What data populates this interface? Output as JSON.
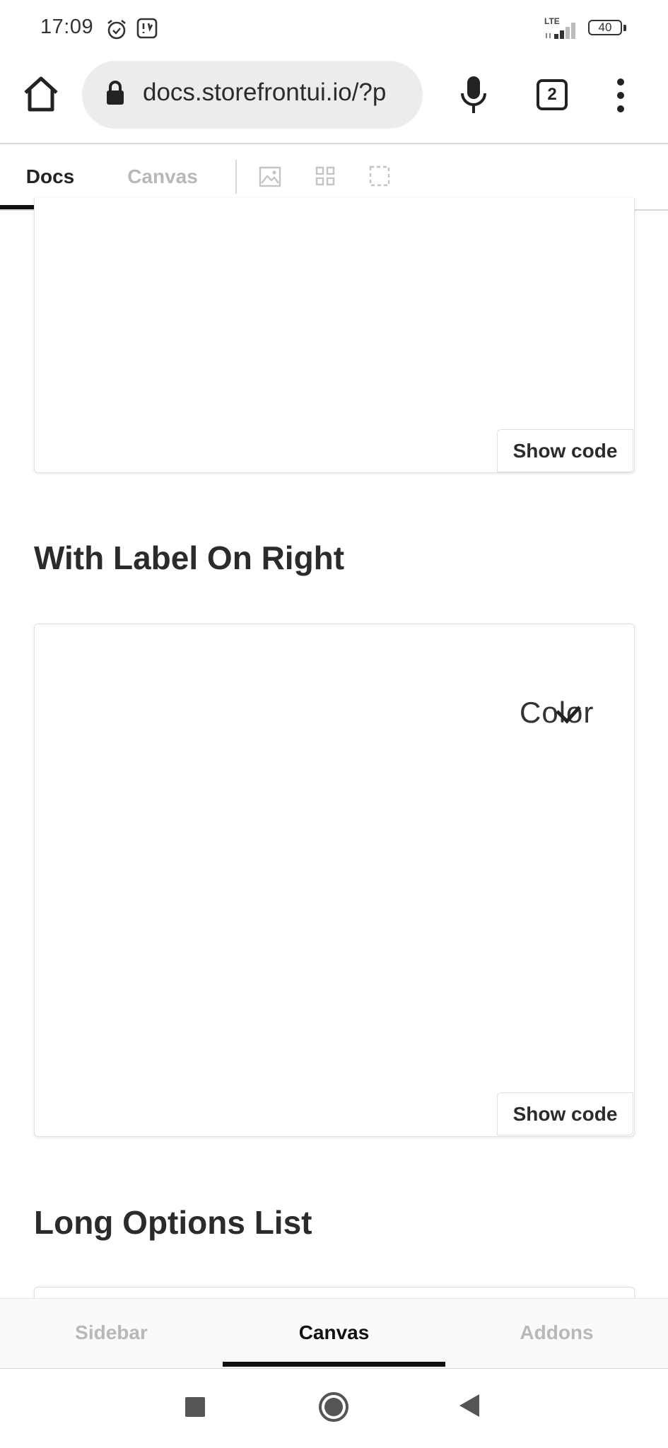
{
  "status_bar": {
    "time": "17:09",
    "network": "LTE",
    "battery": "40"
  },
  "browser": {
    "url": "docs.storefrontui.io/?p",
    "tab_count": "2"
  },
  "docs_tabs": {
    "docs": "Docs",
    "canvas": "Canvas"
  },
  "content": {
    "show_code_label": "Show code",
    "section_label_right": "With Label On Right",
    "select_label": "Color",
    "section_long_list": "Long Options List"
  },
  "bottom_nav": {
    "sidebar": "Sidebar",
    "canvas": "Canvas",
    "addons": "Addons"
  },
  "icons": {
    "status": [
      "alarm-icon",
      "app-notification-icon",
      "signal-icon",
      "battery-icon"
    ],
    "browser": [
      "home-icon",
      "lock-icon",
      "mic-icon",
      "tabs-icon",
      "more-vert-icon"
    ],
    "toolbar": [
      "image-icon",
      "grid-icon",
      "outline-icon"
    ],
    "select": [
      "check-icon"
    ],
    "android": [
      "recent-apps-icon",
      "home-circle-icon",
      "back-icon"
    ]
  }
}
